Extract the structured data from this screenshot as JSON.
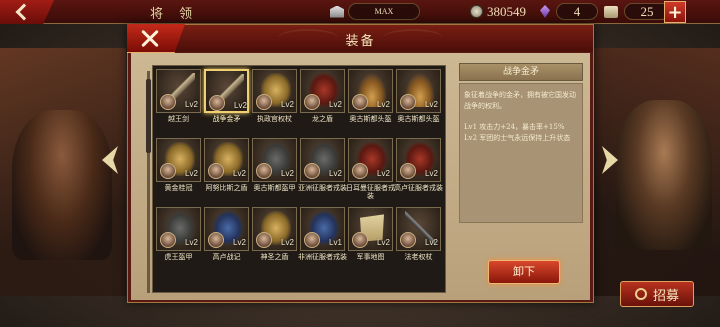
{
  "topbar": {
    "page_title": "将 领",
    "max_label": "MAX",
    "silver": "380549",
    "gems": "4",
    "scrolls": "25",
    "plus_label": "+"
  },
  "background": {
    "recruit_label": "招募"
  },
  "dialog": {
    "title": "装备",
    "items": [
      {
        "name": "越王剑",
        "level": "Lv2",
        "art": "weapon",
        "selected": false
      },
      {
        "name": "战争金矛",
        "level": "Lv2",
        "art": "weapon",
        "selected": true
      },
      {
        "name": "执政官权杖",
        "level": "Lv2",
        "art": "gold",
        "selected": false
      },
      {
        "name": "龙之盾",
        "level": "Lv2",
        "art": "red",
        "selected": false
      },
      {
        "name": "奥古斯都头盔",
        "level": "Lv2",
        "art": "hat",
        "selected": false
      },
      {
        "name": "奥古斯都头盔",
        "level": "Lv2",
        "art": "hat",
        "selected": false
      },
      {
        "name": "黄金桂冠",
        "level": "Lv2",
        "art": "gold",
        "selected": false
      },
      {
        "name": "阿努比斯之盾",
        "level": "Lv2",
        "art": "gold",
        "selected": false
      },
      {
        "name": "奥古斯都盔甲",
        "level": "Lv2",
        "art": "armor",
        "selected": false
      },
      {
        "name": "亚洲征服者戎装",
        "level": "Lv2",
        "art": "armor",
        "selected": false
      },
      {
        "name": "日耳曼征服者戎装",
        "level": "Lv2",
        "art": "red",
        "selected": false
      },
      {
        "name": "高卢征服者戎装",
        "level": "Lv2",
        "art": "red",
        "selected": false
      },
      {
        "name": "虎王盔甲",
        "level": "Lv2",
        "art": "armor",
        "selected": false
      },
      {
        "name": "高卢战记",
        "level": "Lv2",
        "art": "blue",
        "selected": false
      },
      {
        "name": "神圣之盾",
        "level": "Lv2",
        "art": "gold",
        "selected": false
      },
      {
        "name": "非洲征服者戎装",
        "level": "Lv1",
        "art": "blue",
        "selected": false
      },
      {
        "name": "军事地图",
        "level": "Lv2",
        "art": "scroll",
        "selected": false
      },
      {
        "name": "法老权杖",
        "level": "Lv2",
        "art": "staff",
        "selected": false
      }
    ],
    "detail": {
      "title": "战争金矛",
      "description": "象征着战争的金矛，拥有被它国发动战争的权利。",
      "lines": [
        "Lv1  攻击力+24，暴击率+15%",
        "Lv2  军团的士气永远保持上升状态"
      ]
    },
    "unequip_label": "卸下"
  }
}
